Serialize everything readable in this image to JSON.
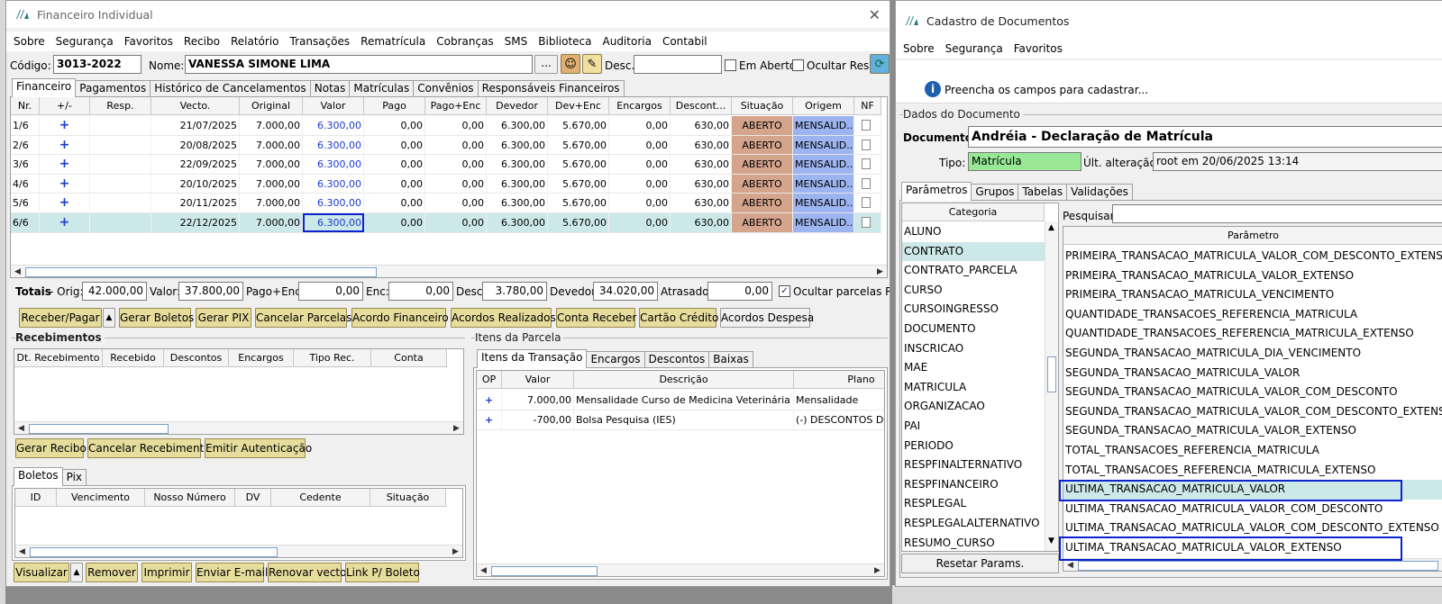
{
  "left": {
    "title": "Financeiro Individual",
    "menu": [
      "Sobre",
      "Segurança",
      "Favoritos",
      "Recibo",
      "Relatório",
      "Transações",
      "Rematrícula",
      "Cobranças",
      "SMS",
      "Biblioteca",
      "Auditoria",
      "Contabil"
    ],
    "codigo_label": "Código:",
    "codigo_value": "3013-2022",
    "nome_label": "Nome:",
    "nome_value": "VANESSA SIMONE LIMA",
    "dots": "...",
    "desc_label": "Desc.:",
    "em_aberto": "Em Aberto",
    "ocultar_resp": "Ocultar Resp.",
    "tabs": [
      "Financeiro",
      "Pagamentos",
      "Histórico de Cancelamentos",
      "Notas",
      "Matrículas",
      "Convênios",
      "Responsáveis Financeiros"
    ],
    "grid_headers": [
      "Nr.",
      "+/-",
      "Resp.",
      "Vecto.",
      "Original",
      "Valor",
      "Pago",
      "Pago+Enc",
      "Devedor",
      "Dev+Enc",
      "Encargos",
      "Descont...",
      "Situação",
      "Origem",
      "NF"
    ],
    "rows": [
      [
        "1/6",
        "+",
        "",
        "21/07/2025",
        "7.000,00",
        "6.300,00",
        "0,00",
        "0,00",
        "6.300,00",
        "5.670,00",
        "0,00",
        "630,00",
        "ABERTO",
        "MENSALID..."
      ],
      [
        "2/6",
        "+",
        "",
        "20/08/2025",
        "7.000,00",
        "6.300,00",
        "0,00",
        "0,00",
        "6.300,00",
        "5.670,00",
        "0,00",
        "630,00",
        "ABERTO",
        "MENSALID..."
      ],
      [
        "3/6",
        "+",
        "",
        "22/09/2025",
        "7.000,00",
        "6.300,00",
        "0,00",
        "0,00",
        "6.300,00",
        "5.670,00",
        "0,00",
        "630,00",
        "ABERTO",
        "MENSALID..."
      ],
      [
        "4/6",
        "+",
        "",
        "20/10/2025",
        "7.000,00",
        "6.300,00",
        "0,00",
        "0,00",
        "6.300,00",
        "5.670,00",
        "0,00",
        "630,00",
        "ABERTO",
        "MENSALID..."
      ],
      [
        "5/6",
        "+",
        "",
        "20/11/2025",
        "7.000,00",
        "6.300,00",
        "0,00",
        "0,00",
        "6.300,00",
        "5.670,00",
        "0,00",
        "630,00",
        "ABERTO",
        "MENSALID..."
      ],
      [
        "6/6",
        "+",
        "",
        "22/12/2025",
        "7.000,00",
        "6.300,00",
        "0,00",
        "0,00",
        "6.300,00",
        "5.670,00",
        "0,00",
        "630,00",
        "ABERTO",
        "MENSALID..."
      ]
    ],
    "totais": {
      "label": "Totais",
      "orig_label": "- Orig:",
      "orig": "42.000,00",
      "valor_label": "Valor:",
      "valor": "37.800,00",
      "pagoenc_label": "Pago+Enc:",
      "pagoenc": "0,00",
      "enc_label": "Enc:",
      "enc": "0,00",
      "desc_label": "Desc:",
      "desc": "3.780,00",
      "devedor_label": "Devedor:",
      "devedor": "34.020,00",
      "atrasado_label": "Atrasado:",
      "atrasado": "0,00",
      "ocultar_label": "Ocultar parcelas RC"
    },
    "buttons": [
      "Receber/Pagar",
      "Gerar Boletos",
      "Gerar PIX",
      "Cancelar Parcelas",
      "Acordo Financeiro",
      "Acordos Realizados",
      "Conta Receber",
      "Cartão Crédito",
      "Acordos Despesa"
    ],
    "recebimentos": {
      "title": "Recebimentos",
      "headers": [
        "Dt. Recebimento",
        "Recebido",
        "Descontos",
        "Encargos",
        "Tipo Rec.",
        "Conta"
      ],
      "buttons": [
        "Gerar Recibo",
        "Cancelar Recebimento",
        "Emitir Autenticação"
      ]
    },
    "itens": {
      "title": "Itens da Parcela",
      "tabs": [
        "Itens da Transação",
        "Encargos",
        "Descontos",
        "Baixas"
      ],
      "headers": [
        "OP",
        "Valor",
        "Descrição",
        "Plano"
      ],
      "rows": [
        [
          "+",
          "7.000,00",
          "Mensalidade Curso de Medicina Veterinária",
          "Mensalidade"
        ],
        [
          "+",
          "-700,00",
          "Bolsa Pesquisa (IES)",
          "(-) DESCONTOS D"
        ]
      ]
    },
    "boletos": {
      "tabs": [
        "Boletos",
        "Pix"
      ],
      "headers": [
        "ID",
        "Vencimento",
        "Nosso Número",
        "DV",
        "Cedente",
        "Situação"
      ],
      "buttons": [
        "Visualizar",
        "Remover",
        "Imprimir",
        "Enviar E-mail",
        "Renovar vecto",
        "Link P/ Boleto"
      ]
    }
  },
  "right": {
    "title": "Cadastro de Documentos",
    "menu": [
      "Sobre",
      "Segurança",
      "Favoritos"
    ],
    "info": "Preencha os campos para cadastrar...",
    "group_title": "Dados do Documento",
    "documento_label": "Documento:",
    "documento_value": "Andréia - Declaração de Matrícula",
    "tipo_label": "Tipo:",
    "tipo_value": "Matrícula",
    "ult_label": "Últ. alteração:",
    "ult_value": "root em 20/06/2025 13:14",
    "tabs": [
      "Parâmetros",
      "Grupos",
      "Tabelas",
      "Validações"
    ],
    "categoria_header": "Categoria",
    "categorias": [
      "ALUNO",
      "CONTRATO",
      "CONTRATO_PARCELA",
      "CURSO",
      "CURSOINGRESSO",
      "DOCUMENTO",
      "INSCRICAO",
      "MAE",
      "MATRICULA",
      "ORGANIZACAO",
      "PAI",
      "PERIODO",
      "RESPFINALTERNATIVO",
      "RESPFINANCEIRO",
      "RESPLEGAL",
      "RESPLEGALALTERNATIVO",
      "RESUMO_CURSO"
    ],
    "pesquisar_label": "Pesquisar:",
    "parametro_header": "Parâmetro",
    "parametros": [
      "PRIMEIRA_TRANSACAO_MATRICULA_VALOR_COM_DESCONTO_EXTENSO",
      "PRIMEIRA_TRANSACAO_MATRICULA_VALOR_EXTENSO",
      "PRIMEIRA_TRANSACAO_MATRICULA_VENCIMENTO",
      "QUANTIDADE_TRANSACOES_REFERENCIA_MATRICULA",
      "QUANTIDADE_TRANSACOES_REFERENCIA_MATRICULA_EXTENSO",
      "SEGUNDA_TRANSACAO_MATRICULA_DIA_VENCIMENTO",
      "SEGUNDA_TRANSACAO_MATRICULA_VALOR",
      "SEGUNDA_TRANSACAO_MATRICULA_VALOR_COM_DESCONTO",
      "SEGUNDA_TRANSACAO_MATRICULA_VALOR_COM_DESCONTO_EXTENSO",
      "SEGUNDA_TRANSACAO_MATRICULA_VALOR_EXTENSO",
      "TOTAL_TRANSACOES_REFERENCIA_MATRICULA",
      "TOTAL_TRANSACOES_REFERENCIA_MATRICULA_EXTENSO",
      "ULTIMA_TRANSACAO_MATRICULA_VALOR",
      "ULTIMA_TRANSACAO_MATRICULA_VALOR_COM_DESCONTO",
      "ULTIMA_TRANSACAO_MATRICULA_VALOR_COM_DESCONTO_EXTENSO",
      "ULTIMA_TRANSACAO_MATRICULA_VALOR_EXTENSO"
    ],
    "reset_button": "Resetar Params."
  },
  "colors": {
    "aberto_bg": "#d4a48c",
    "origem_bg": "#9cb4f0",
    "selected_row": "#cde8e8",
    "highlight_border": "#0a22d0",
    "button_bg": "#e6dc9c",
    "tipo_bg": "#98e898"
  }
}
